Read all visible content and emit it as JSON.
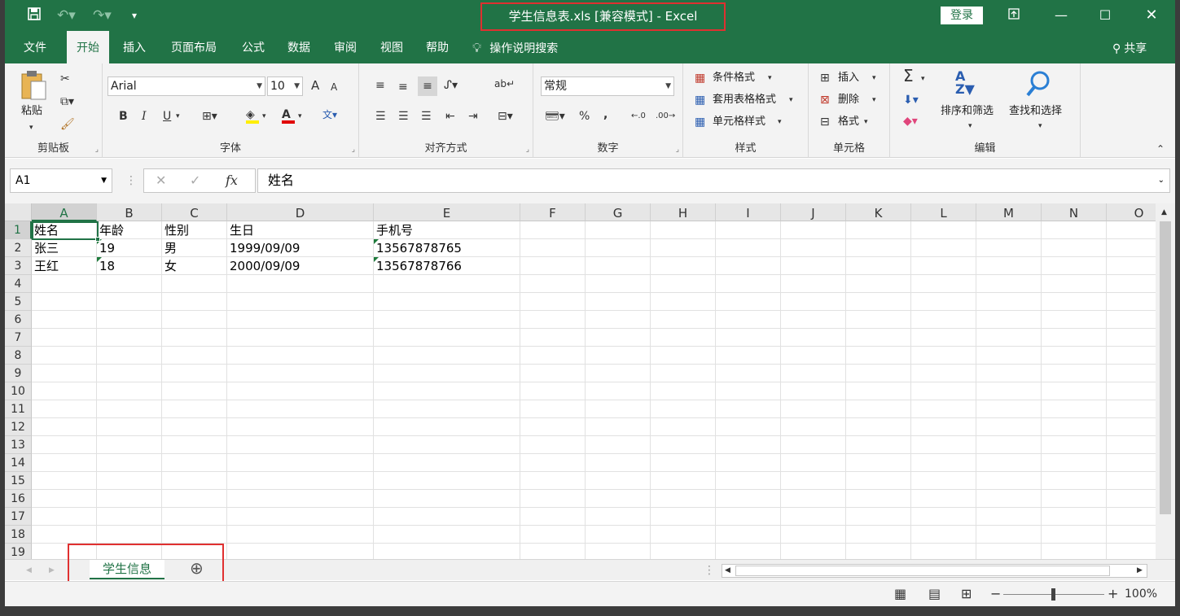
{
  "titlebar": {
    "title": "学生信息表.xls  [兼容模式]  -  Excel",
    "login_label": "登录",
    "save_icon": "save-icon",
    "undo_icon": "undo-icon",
    "redo_icon": "redo-icon"
  },
  "tabs": [
    "文件",
    "开始",
    "插入",
    "页面布局",
    "公式",
    "数据",
    "审阅",
    "视图",
    "帮助"
  ],
  "active_tab": "开始",
  "tell_me": "操作说明搜索",
  "share": "共享",
  "ribbon": {
    "clipboard": {
      "label": "剪贴板",
      "paste": "粘贴"
    },
    "font": {
      "label": "字体",
      "name": "Arial",
      "size": "10",
      "bold": "B",
      "italic": "I",
      "underline": "U",
      "grow": "A",
      "shrink": "A"
    },
    "alignment": {
      "label": "对齐方式"
    },
    "number": {
      "label": "数字",
      "format": "常规",
      "percent": "%",
      "comma": ","
    },
    "styles": {
      "label": "样式",
      "conditional": "条件格式",
      "table_format": "套用表格格式",
      "cell_styles": "单元格样式"
    },
    "cells": {
      "label": "单元格",
      "insert": "插入",
      "delete": "删除",
      "format": "格式"
    },
    "editing": {
      "label": "编辑",
      "sort_filter": "排序和筛选",
      "find_select": "查找和选择",
      "sum": "Σ"
    }
  },
  "formula_bar": {
    "name_box": "A1",
    "fx": "fx",
    "value": "姓名"
  },
  "columns": [
    "A",
    "B",
    "C",
    "D",
    "E",
    "F",
    "G",
    "H",
    "I",
    "J",
    "K",
    "L",
    "M",
    "N",
    "O"
  ],
  "rows": [
    "1",
    "2",
    "3",
    "4",
    "5",
    "6",
    "7",
    "8",
    "9",
    "10",
    "11",
    "12",
    "13",
    "14",
    "15",
    "16",
    "17",
    "18",
    "19"
  ],
  "table": [
    [
      "姓名",
      "年龄",
      "性别",
      "生日",
      "手机号"
    ],
    [
      "张三",
      "19",
      "男",
      "1999/09/09",
      "13567878765"
    ],
    [
      "王红",
      "18",
      "女",
      "2000/09/09",
      "13567878766"
    ]
  ],
  "sheet": {
    "name": "学生信息",
    "add": "⊕"
  },
  "status": {
    "zoom": "100%"
  },
  "colors": {
    "accent": "#217346",
    "highlight_box": "#e03030"
  }
}
